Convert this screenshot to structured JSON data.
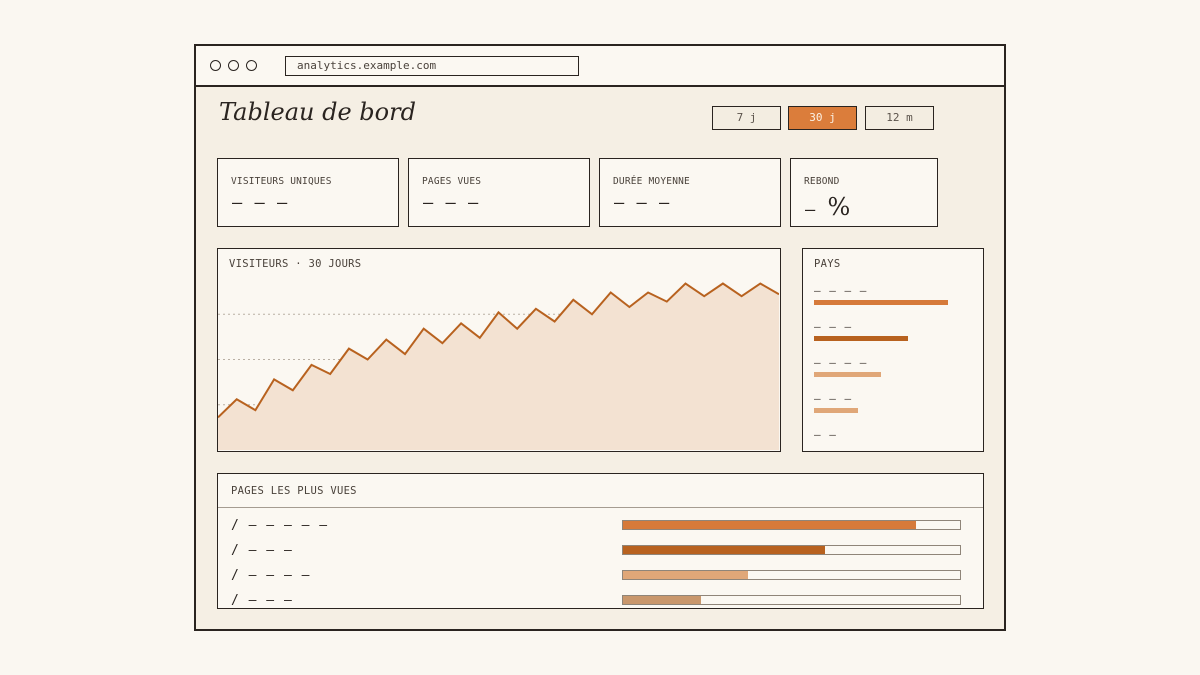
{
  "browser": {
    "url": "analytics.example.com"
  },
  "dashboard": {
    "title": "Tableau de bord",
    "ranges": [
      {
        "label": "7 j",
        "active": false
      },
      {
        "label": "30 j",
        "active": true
      },
      {
        "label": "12 m",
        "active": false
      }
    ]
  },
  "stats": [
    {
      "label": "VISITEURS UNIQUES",
      "value": "— — —"
    },
    {
      "label": "PAGES VUES",
      "value": "— — —"
    },
    {
      "label": "DURÉE MOYENNE",
      "value": "— — —"
    },
    {
      "label": "REBOND",
      "value": "—",
      "suffix": "%"
    }
  ],
  "visitors_chart": {
    "label": "VISITEURS · 30 JOURS"
  },
  "countries": {
    "label": "PAYS",
    "items": [
      {
        "name": "– – – –",
        "share": 1.0,
        "color": "#d67a3a"
      },
      {
        "name": "– – –",
        "share": 0.7,
        "color": "#b8621f"
      },
      {
        "name": "– – – –",
        "share": 0.5,
        "color": "#e0a778"
      },
      {
        "name": "– – –",
        "share": 0.33,
        "color": "#e0a778"
      },
      {
        "name": "– –",
        "share": 0,
        "color": "#e0a778"
      }
    ]
  },
  "top_pages": {
    "label": "PAGES LES PLUS VUES",
    "items": [
      {
        "path": "/ – – – – –",
        "share": 0.87,
        "color": "#d67a3a"
      },
      {
        "path": "/ – – –",
        "share": 0.6,
        "color": "#b8621f"
      },
      {
        "path": "/ – – – –",
        "share": 0.37,
        "color": "#e0a778"
      },
      {
        "path": "/ – – –",
        "share": 0.23,
        "color": "#c9976c"
      }
    ]
  },
  "chart_data": {
    "type": "area",
    "title": "VISITEURS · 30 JOURS",
    "x": [
      1,
      2,
      3,
      4,
      5,
      6,
      7,
      8,
      9,
      10,
      11,
      12,
      13,
      14,
      15,
      16,
      17,
      18,
      19,
      20,
      21,
      22,
      23,
      24,
      25,
      26,
      27,
      28,
      29,
      30,
      31
    ],
    "values": [
      0.18,
      0.28,
      0.22,
      0.39,
      0.33,
      0.47,
      0.42,
      0.56,
      0.5,
      0.61,
      0.53,
      0.67,
      0.59,
      0.7,
      0.62,
      0.76,
      0.67,
      0.78,
      0.71,
      0.83,
      0.75,
      0.87,
      0.79,
      0.87,
      0.82,
      0.92,
      0.85,
      0.92,
      0.85,
      0.92,
      0.86
    ],
    "ylim": [
      0,
      1
    ],
    "grid": true,
    "line_color": "#b8621f",
    "fill_color": "#f3e2d2"
  }
}
